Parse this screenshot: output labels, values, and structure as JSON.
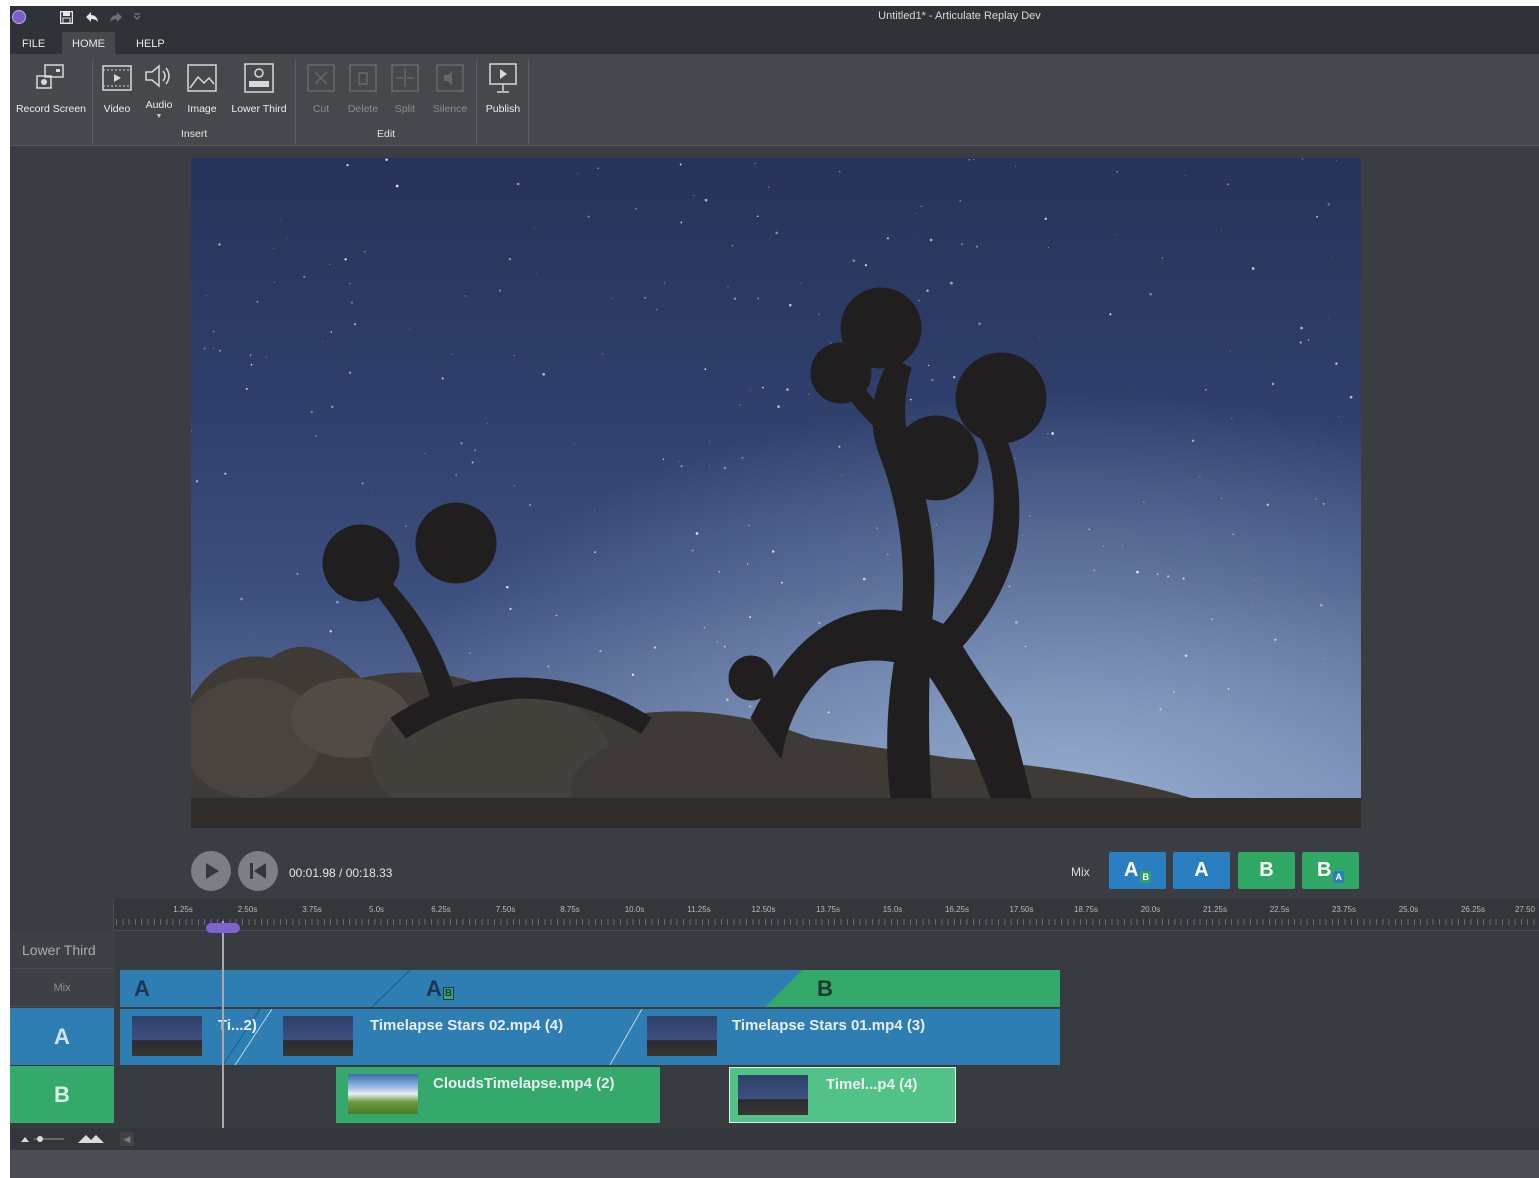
{
  "titlebar": {
    "title": "Untitled1* - Articulate Replay Dev",
    "save_icon": "save-icon",
    "undo_icon": "undo-icon",
    "redo_icon": "redo-icon",
    "customize_icon": "customize-quick-access-icon"
  },
  "menu": {
    "file": "FILE",
    "home": "HOME",
    "help": "HELP"
  },
  "ribbon": {
    "record_screen": "Record Screen",
    "video": "Video",
    "audio": "Audio",
    "image": "Image",
    "lower_third": "Lower Third",
    "insert_group": "Insert",
    "cut": "Cut",
    "delete": "Delete",
    "split": "Split",
    "silence": "Silence",
    "publish": "Publish",
    "edit_group": "Edit"
  },
  "player": {
    "time": "00:01.98 / 00:18.33",
    "progress_fraction": 0.108
  },
  "mix": {
    "label": "Mix",
    "buttons": [
      {
        "main": "A",
        "sub": "B",
        "color": "#2a7fc0",
        "sub_color": "#32a066"
      },
      {
        "main": "A",
        "sub": "",
        "color": "#2a7fc0"
      },
      {
        "main": "B",
        "sub": "",
        "color": "#2fa864"
      },
      {
        "main": "B",
        "sub": "A",
        "color": "#2fa864",
        "sub_color": "#2a7fc0"
      }
    ]
  },
  "timeline": {
    "ticks": [
      "1.25s",
      "2.50s",
      "3.75s",
      "5.0s",
      "6.25s",
      "7.50s",
      "8.75s",
      "10.0s",
      "11.25s",
      "12.50s",
      "13.75s",
      "15.0s",
      "16.25s",
      "17.50s",
      "18.75s",
      "20.0s",
      "21.25s",
      "22.5s",
      "23.75s",
      "25.0s",
      "26.25s",
      "27.50"
    ],
    "tracks": {
      "lower_third": "Lower Third",
      "mix": "Mix",
      "a": "A",
      "b": "B"
    },
    "mix_segments": [
      {
        "label": "A",
        "sub": ""
      },
      {
        "label": "A",
        "sub": "B"
      },
      {
        "label": "B",
        "sub": ""
      }
    ],
    "clips_a": [
      {
        "name": "Ti...2)"
      },
      {
        "name": "Timelapse Stars 02.mp4 (4)"
      },
      {
        "name": "Timelapse Stars 01.mp4 (3)"
      }
    ],
    "clips_b": [
      {
        "name": "CloudsTimelapse.mp4 (2)"
      },
      {
        "name": "Timel...p4 (4)"
      }
    ]
  },
  "colors": {
    "track_a": "#2e7db3",
    "track_b": "#35a86c",
    "playhead": "#7b63d0"
  }
}
